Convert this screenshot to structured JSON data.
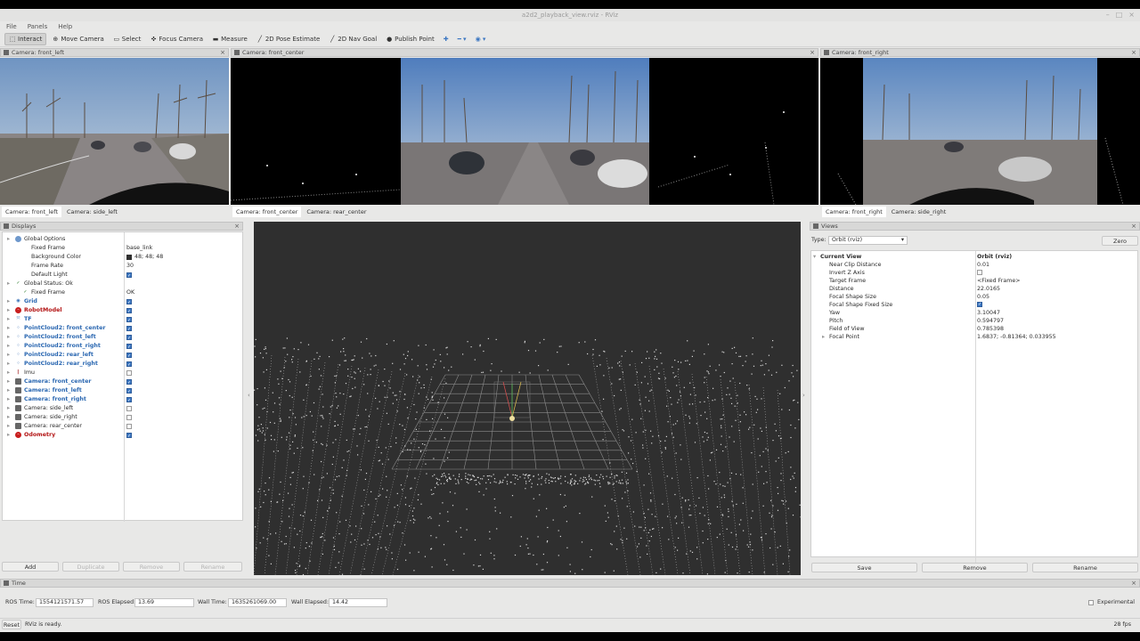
{
  "window": {
    "title": "a2d2_playback_view.rviz - RViz",
    "controls": [
      "–",
      "□",
      "×"
    ]
  },
  "menu": [
    "File",
    "Panels",
    "Help"
  ],
  "toolbar": [
    {
      "label": "Interact",
      "icon": "interact-icon",
      "glyph": "⬚",
      "active": true
    },
    {
      "label": "Move Camera",
      "icon": "move-camera-icon",
      "glyph": "⊕"
    },
    {
      "label": "Select",
      "icon": "select-icon",
      "glyph": "▭"
    },
    {
      "label": "Focus Camera",
      "icon": "focus-camera-icon",
      "glyph": "✜"
    },
    {
      "label": "Measure",
      "icon": "measure-icon",
      "glyph": "▬"
    },
    {
      "label": "2D Pose Estimate",
      "icon": "pose-estimate-icon",
      "glyph": "╱"
    },
    {
      "label": "2D Nav Goal",
      "icon": "nav-goal-icon",
      "glyph": "╱"
    },
    {
      "label": "Publish Point",
      "icon": "publish-point-icon",
      "glyph": "●"
    }
  ],
  "toolbar_extra": {
    "plus": "✚",
    "minus": "━ ▾",
    "eye": "◉ ▾"
  },
  "cameras": {
    "left": {
      "title": "Camera: front_left",
      "tabs": [
        "Camera: front_left",
        "Camera: side_left"
      ]
    },
    "center": {
      "title": "Camera: front_center",
      "tabs": [
        "Camera: front_center",
        "Camera: rear_center"
      ]
    },
    "right": {
      "title": "Camera: front_right",
      "tabs": [
        "Camera: front_right",
        "Camera: side_right"
      ]
    }
  },
  "displays": {
    "title": "Displays",
    "rows": [
      {
        "label": "Global Options",
        "indent": 1,
        "value": "",
        "icon": "options-icon"
      },
      {
        "label": "Fixed Frame",
        "indent": 2,
        "value": "base_link"
      },
      {
        "label": "Background Color",
        "indent": 2,
        "value": "48; 48; 48",
        "swatch": true
      },
      {
        "label": "Frame Rate",
        "indent": 2,
        "value": "30"
      },
      {
        "label": "Default Light",
        "indent": 2,
        "check": true
      },
      {
        "label": "Global Status: Ok",
        "indent": 1,
        "icon": "status-ok-icon"
      },
      {
        "label": "Fixed Frame",
        "indent": 2,
        "value": "OK",
        "icon": "status-ok-icon"
      },
      {
        "label": "Grid",
        "indent": 1,
        "check": true,
        "style": "blue",
        "icon": "grid-icon"
      },
      {
        "label": "RobotModel",
        "indent": 1,
        "check": true,
        "style": "red",
        "icon": "error-icon"
      },
      {
        "label": "TF",
        "indent": 1,
        "check": true,
        "style": "blue",
        "icon": "tf-icon"
      },
      {
        "label": "PointCloud2: front_center",
        "indent": 1,
        "check": true,
        "style": "blue",
        "icon": "pointcloud-icon"
      },
      {
        "label": "PointCloud2: front_left",
        "indent": 1,
        "check": true,
        "style": "blue",
        "icon": "pointcloud-icon"
      },
      {
        "label": "PointCloud2: front_right",
        "indent": 1,
        "check": true,
        "style": "blue",
        "icon": "pointcloud-icon"
      },
      {
        "label": "PointCloud2: rear_left",
        "indent": 1,
        "check": true,
        "style": "blue",
        "icon": "pointcloud-icon"
      },
      {
        "label": "PointCloud2: rear_right",
        "indent": 1,
        "check": true,
        "style": "blue",
        "icon": "pointcloud-icon"
      },
      {
        "label": "Imu",
        "indent": 1,
        "check": false,
        "icon": "imu-icon"
      },
      {
        "label": "Camera: front_center",
        "indent": 1,
        "check": true,
        "style": "blue",
        "icon": "camera-icon"
      },
      {
        "label": "Camera: front_left",
        "indent": 1,
        "check": true,
        "style": "blue",
        "icon": "camera-icon"
      },
      {
        "label": "Camera: front_right",
        "indent": 1,
        "check": true,
        "style": "blue",
        "icon": "camera-icon"
      },
      {
        "label": "Camera: side_left",
        "indent": 1,
        "check": false,
        "icon": "camera-icon"
      },
      {
        "label": "Camera: side_right",
        "indent": 1,
        "check": false,
        "icon": "camera-icon"
      },
      {
        "label": "Camera: rear_center",
        "indent": 1,
        "check": false,
        "icon": "camera-icon"
      },
      {
        "label": "Odometry",
        "indent": 1,
        "check": true,
        "style": "red",
        "icon": "error-icon"
      }
    ],
    "buttons": {
      "add": "Add",
      "duplicate": "Duplicate",
      "remove": "Remove",
      "rename": "Rename"
    }
  },
  "views": {
    "title": "Views",
    "type_label": "Type:",
    "type_value": "Orbit (rviz)",
    "zero": "Zero",
    "rows": [
      {
        "label": "Current View",
        "value": "Orbit (rviz)",
        "bold": true
      },
      {
        "label": "Near Clip Distance",
        "value": "0.01"
      },
      {
        "label": "Invert Z Axis",
        "check": false
      },
      {
        "label": "Target Frame",
        "value": "<Fixed Frame>"
      },
      {
        "label": "Distance",
        "value": "22.0165"
      },
      {
        "label": "Focal Shape Size",
        "value": "0.05"
      },
      {
        "label": "Focal Shape Fixed Size",
        "check": true
      },
      {
        "label": "Yaw",
        "value": "3.10047"
      },
      {
        "label": "Pitch",
        "value": "0.594797"
      },
      {
        "label": "Field of View",
        "value": "0.785398"
      },
      {
        "label": "Focal Point",
        "value": "1.6837; -0.81364; 0.033955"
      }
    ],
    "buttons": {
      "save": "Save",
      "remove": "Remove",
      "rename": "Rename"
    }
  },
  "time": {
    "title": "Time",
    "ros_time_label": "ROS Time:",
    "ros_time": "1554121571.57",
    "ros_elapsed_label": "ROS Elapsed:",
    "ros_elapsed": "13.69",
    "wall_time_label": "Wall Time:",
    "wall_time": "1635261069.00",
    "wall_elapsed_label": "Wall Elapsed:",
    "wall_elapsed": "14.42",
    "experimental": "Experimental"
  },
  "status": {
    "reset": "Reset",
    "message": "RViz is ready.",
    "fps": "28 fps"
  },
  "colors": {
    "accent": "#3c77c2",
    "error": "#b31414",
    "viewport_bg": "#2f2f2f"
  }
}
